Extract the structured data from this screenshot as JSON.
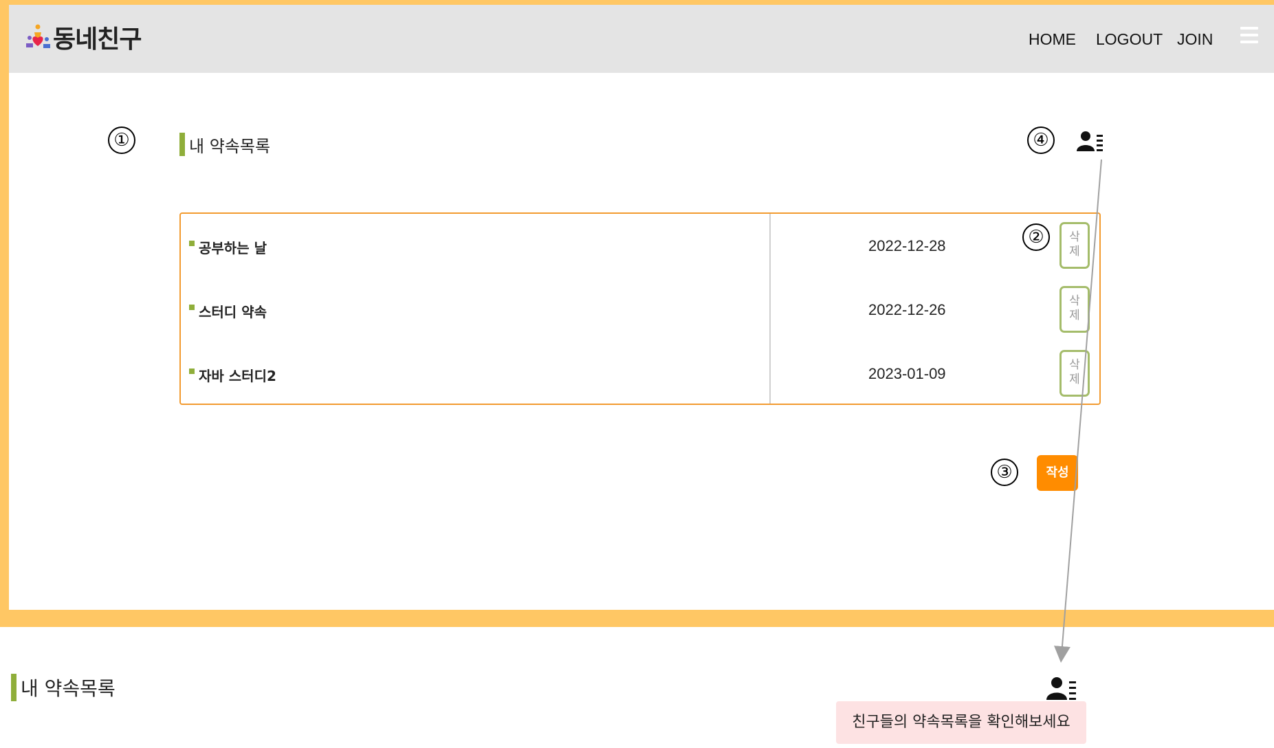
{
  "header": {
    "logo_text": "동네친구",
    "nav": {
      "home": "HOME",
      "logout": "LOGOUT",
      "join": "JOIN"
    }
  },
  "markers": {
    "m1": "①",
    "m2": "②",
    "m3": "③",
    "m4": "④"
  },
  "main": {
    "section_title": "내 약속목록",
    "appointments": [
      {
        "title": "공부하는 날",
        "date": "2022-12-28"
      },
      {
        "title": "스터디 약속",
        "date": "2022-12-26"
      },
      {
        "title": "자바 스터디2",
        "date": "2023-01-09"
      }
    ],
    "delete_label_top": "삭",
    "delete_label_bottom": "제",
    "write_label": "작성"
  },
  "preview": {
    "section_title": "내 약속목록",
    "tooltip": "친구들의 약속목록을 확인해보세요"
  },
  "colors": {
    "frame": "#ffc764",
    "accent_green": "#8fae3a",
    "box_border": "#f29a2e",
    "write_button": "#ff8c00",
    "tooltip_bg": "#fde2e3"
  }
}
